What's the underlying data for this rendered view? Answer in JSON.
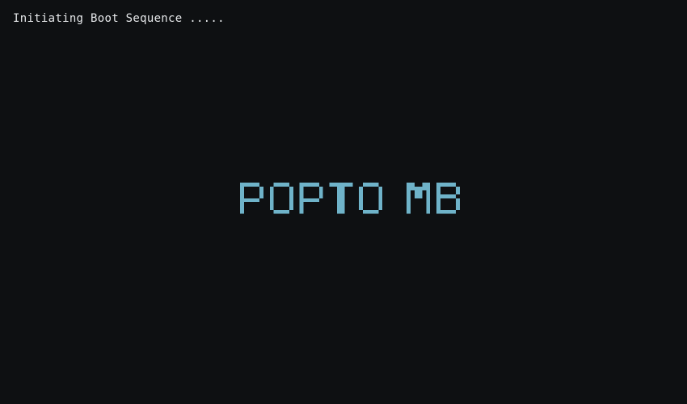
{
  "boot": {
    "status_text": "Initiating Boot Sequence ....."
  },
  "logo": {
    "text": "POPTO MB",
    "color": "#6fb3c9"
  },
  "colors": {
    "background": "#0e1012",
    "status_text": "#e6e8ea",
    "logo": "#6fb3c9"
  }
}
